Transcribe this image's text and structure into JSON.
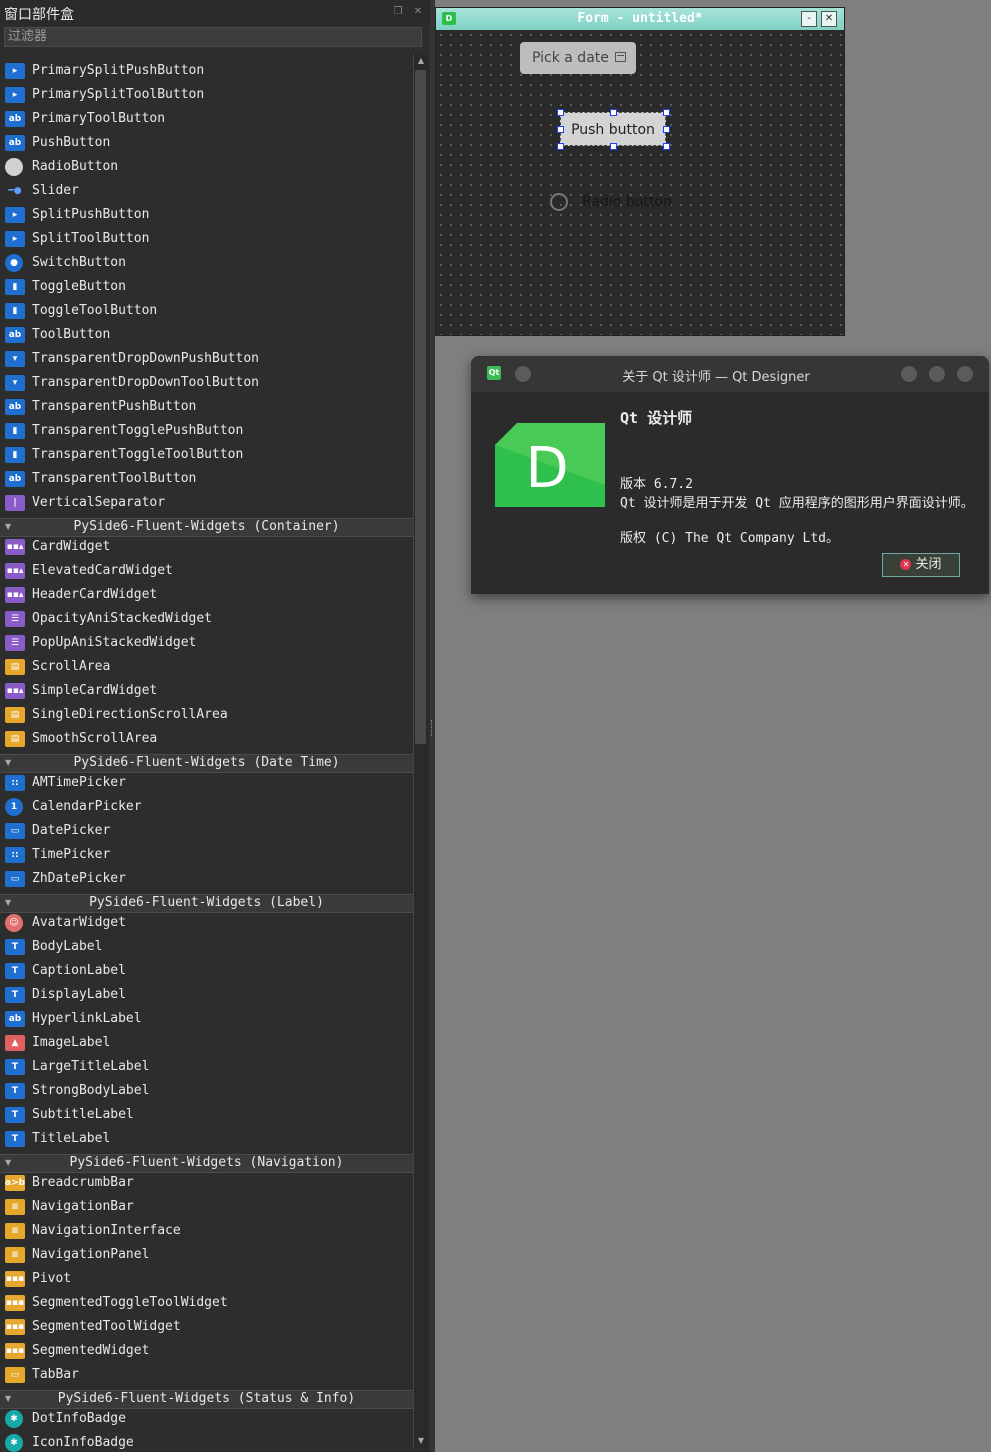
{
  "widget_box": {
    "title": "窗口部件盒",
    "filter_placeholder": "过滤器",
    "entries": [
      {
        "kind": "item",
        "label": "PrimarySplitPushButton",
        "icon": "split-button-icon"
      },
      {
        "kind": "item",
        "label": "PrimarySplitToolButton",
        "icon": "split-button-icon"
      },
      {
        "kind": "item",
        "label": "PrimaryToolButton",
        "icon": "ab-button-icon"
      },
      {
        "kind": "item",
        "label": "PushButton",
        "icon": "ab-button-icon"
      },
      {
        "kind": "item",
        "label": "RadioButton",
        "icon": "radio-icon"
      },
      {
        "kind": "item",
        "label": "Slider",
        "icon": "slider-icon"
      },
      {
        "kind": "item",
        "label": "SplitPushButton",
        "icon": "split-button-icon"
      },
      {
        "kind": "item",
        "label": "SplitToolButton",
        "icon": "split-button-icon"
      },
      {
        "kind": "item",
        "label": "SwitchButton",
        "icon": "switch-icon"
      },
      {
        "kind": "item",
        "label": "ToggleButton",
        "icon": "toggle-icon"
      },
      {
        "kind": "item",
        "label": "ToggleToolButton",
        "icon": "toggle-icon"
      },
      {
        "kind": "item",
        "label": "ToolButton",
        "icon": "ab-button-icon"
      },
      {
        "kind": "item",
        "label": "TransparentDropDownPushButton",
        "icon": "dropdown-icon"
      },
      {
        "kind": "item",
        "label": "TransparentDropDownToolButton",
        "icon": "dropdown-icon"
      },
      {
        "kind": "item",
        "label": "TransparentPushButton",
        "icon": "ab-button-icon"
      },
      {
        "kind": "item",
        "label": "TransparentTogglePushButton",
        "icon": "toggle-icon"
      },
      {
        "kind": "item",
        "label": "TransparentToggleToolButton",
        "icon": "toggle-icon"
      },
      {
        "kind": "item",
        "label": "TransparentToolButton",
        "icon": "ab-button-icon"
      },
      {
        "kind": "item",
        "label": "VerticalSeparator",
        "icon": "separator-icon"
      },
      {
        "kind": "category",
        "label": "PySide6-Fluent-Widgets (Container)"
      },
      {
        "kind": "item",
        "label": "CardWidget",
        "icon": "card-icon"
      },
      {
        "kind": "item",
        "label": "ElevatedCardWidget",
        "icon": "card-icon"
      },
      {
        "kind": "item",
        "label": "HeaderCardWidget",
        "icon": "card-icon"
      },
      {
        "kind": "item",
        "label": "OpacityAniStackedWidget",
        "icon": "stacked-icon"
      },
      {
        "kind": "item",
        "label": "PopUpAniStackedWidget",
        "icon": "stacked-icon"
      },
      {
        "kind": "item",
        "label": "ScrollArea",
        "icon": "scroll-area-icon"
      },
      {
        "kind": "item",
        "label": "SimpleCardWidget",
        "icon": "card-icon"
      },
      {
        "kind": "item",
        "label": "SingleDirectionScrollArea",
        "icon": "scroll-area-icon"
      },
      {
        "kind": "item",
        "label": "SmoothScrollArea",
        "icon": "scroll-area-icon"
      },
      {
        "kind": "category",
        "label": "PySide6-Fluent-Widgets (Date Time)"
      },
      {
        "kind": "item",
        "label": "AMTimePicker",
        "icon": "time-picker-icon"
      },
      {
        "kind": "item",
        "label": "CalendarPicker",
        "icon": "calendar-icon"
      },
      {
        "kind": "item",
        "label": "DatePicker",
        "icon": "date-picker-icon"
      },
      {
        "kind": "item",
        "label": "TimePicker",
        "icon": "time-picker-icon"
      },
      {
        "kind": "item",
        "label": "ZhDatePicker",
        "icon": "date-picker-icon"
      },
      {
        "kind": "category",
        "label": "PySide6-Fluent-Widgets (Label)"
      },
      {
        "kind": "item",
        "label": "AvatarWidget",
        "icon": "avatar-icon"
      },
      {
        "kind": "item",
        "label": "BodyLabel",
        "icon": "text-label-icon"
      },
      {
        "kind": "item",
        "label": "CaptionLabel",
        "icon": "text-label-icon"
      },
      {
        "kind": "item",
        "label": "DisplayLabel",
        "icon": "text-label-icon"
      },
      {
        "kind": "item",
        "label": "HyperlinkLabel",
        "icon": "ab-button-icon"
      },
      {
        "kind": "item",
        "label": "ImageLabel",
        "icon": "image-icon"
      },
      {
        "kind": "item",
        "label": "LargeTitleLabel",
        "icon": "text-label-icon"
      },
      {
        "kind": "item",
        "label": "StrongBodyLabel",
        "icon": "text-label-icon"
      },
      {
        "kind": "item",
        "label": "SubtitleLabel",
        "icon": "text-label-icon"
      },
      {
        "kind": "item",
        "label": "TitleLabel",
        "icon": "text-label-icon"
      },
      {
        "kind": "category",
        "label": "PySide6-Fluent-Widgets (Navigation)"
      },
      {
        "kind": "item",
        "label": "BreadcrumbBar",
        "icon": "breadcrumb-icon"
      },
      {
        "kind": "item",
        "label": "NavigationBar",
        "icon": "navigation-icon"
      },
      {
        "kind": "item",
        "label": "NavigationInterface",
        "icon": "navigation-icon"
      },
      {
        "kind": "item",
        "label": "NavigationPanel",
        "icon": "navigation-icon"
      },
      {
        "kind": "item",
        "label": "Pivot",
        "icon": "segmented-icon"
      },
      {
        "kind": "item",
        "label": "SegmentedToggleToolWidget",
        "icon": "segmented-icon"
      },
      {
        "kind": "item",
        "label": "SegmentedToolWidget",
        "icon": "segmented-icon"
      },
      {
        "kind": "item",
        "label": "SegmentedWidget",
        "icon": "segmented-icon"
      },
      {
        "kind": "item",
        "label": "TabBar",
        "icon": "tabbar-icon"
      },
      {
        "kind": "category",
        "label": "PySide6-Fluent-Widgets (Status & Info)"
      },
      {
        "kind": "item",
        "label": "DotInfoBadge",
        "icon": "info-badge-icon"
      },
      {
        "kind": "item",
        "label": "IconInfoBadge",
        "icon": "info-badge-icon"
      }
    ]
  },
  "form_window": {
    "title": "Form - untitled*",
    "minimize_label": "-",
    "close_label": "✕",
    "pick_date_label": "Pick a date",
    "push_button_label": "Push button",
    "radio_button_label": "Radio button"
  },
  "about_dialog": {
    "title": "关于 Qt 设计师 — Qt Designer",
    "app_name": "Qt 设计师",
    "logo_letter": "D",
    "version": "版本 6.7.2",
    "description": "Qt 设计师是用于开发 Qt 应用程序的图形用户界面设计师。",
    "copyright": "版权 (C) The Qt Company Ltd。",
    "close_button": "关闭"
  },
  "colors": {
    "accent_blue": "#1e6fd0",
    "logo_green": "#2fbf4c",
    "title_teal": "#8fd8cc"
  }
}
